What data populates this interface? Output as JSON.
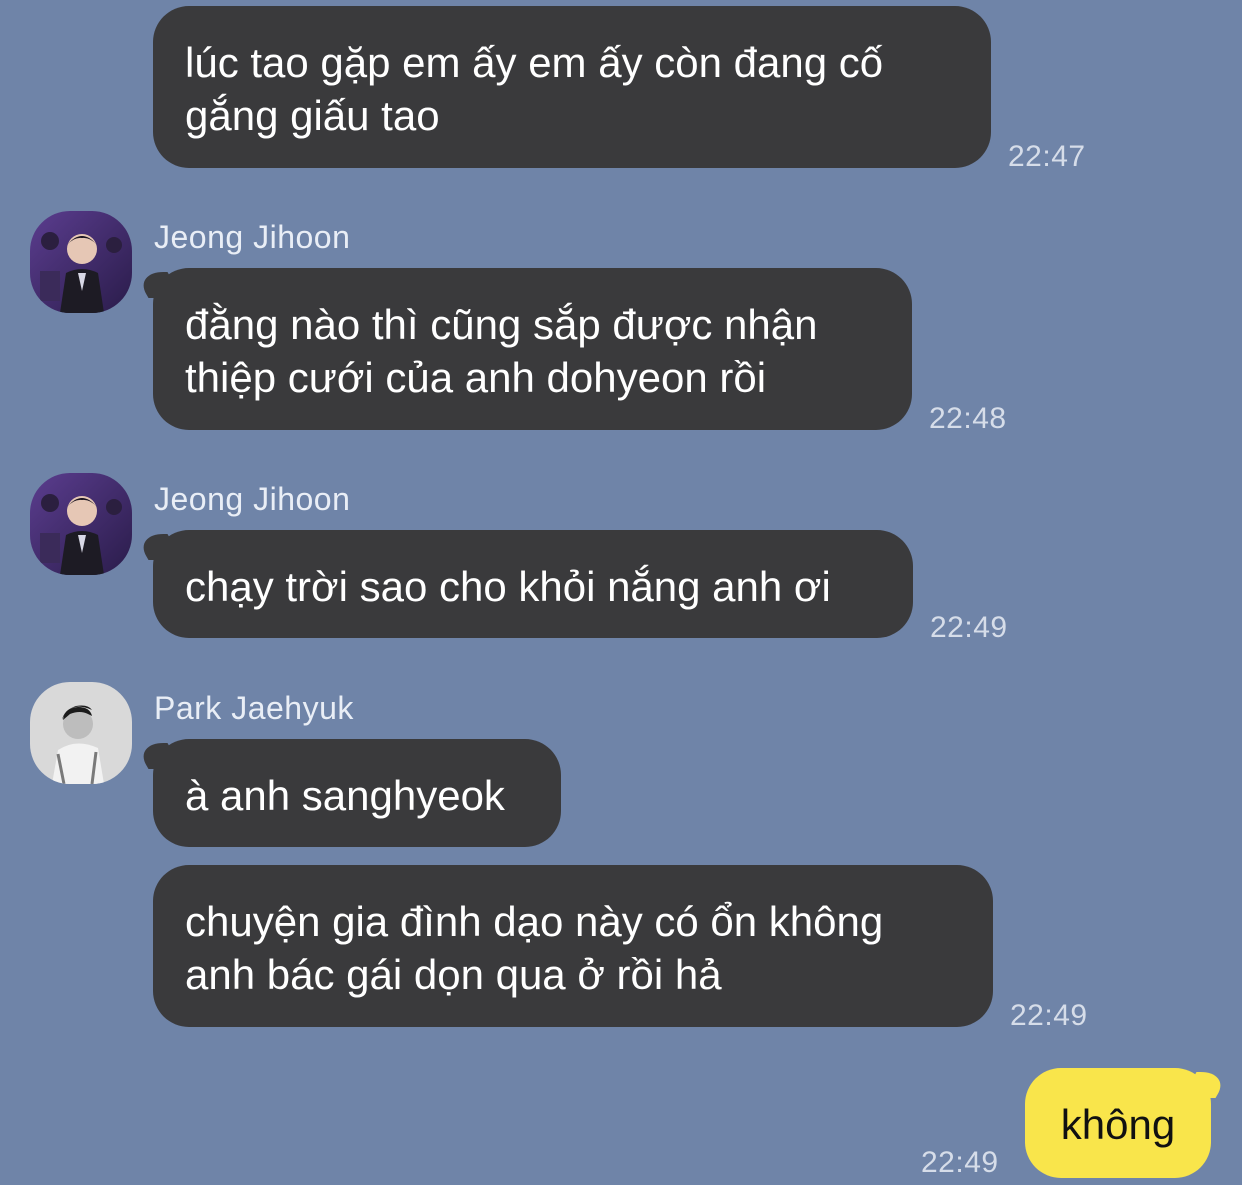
{
  "messages": [
    {
      "sender": "",
      "text": "lúc tao gặp em ấy em ấy còn đang cố\ngắng giấu tao",
      "time": "22:47"
    },
    {
      "sender": "Jeong Jihoon",
      "text": "đằng nào thì cũng sắp được nhận\nthiệp cưới của anh dohyeon rồi",
      "time": "22:48"
    },
    {
      "sender": "Jeong Jihoon",
      "text": "chạy trời sao cho khỏi nắng anh ơi",
      "time": "22:49"
    },
    {
      "sender": "Park Jaehyuk",
      "text": "à anh sanghyeok",
      "time": ""
    },
    {
      "sender": "",
      "text": "chuyện gia đình dạo này có ổn không\nanh bác gái dọn qua ở rồi hả",
      "time": "22:49"
    },
    {
      "sender": "me",
      "text": "không",
      "time": "22:49"
    }
  ],
  "colors": {
    "background": "#6f84a8",
    "incoming_bubble": "#3a3a3c",
    "outgoing_bubble": "#f9e54b"
  }
}
